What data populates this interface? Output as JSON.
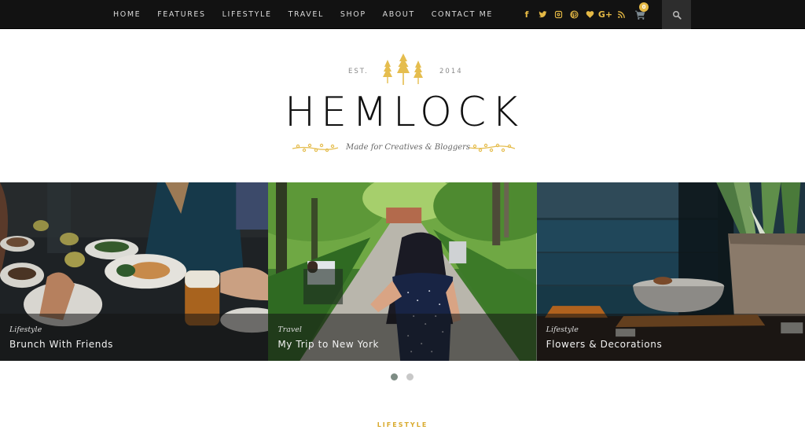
{
  "nav": {
    "items": [
      {
        "label": "HOME"
      },
      {
        "label": "FEATURES"
      },
      {
        "label": "LIFESTYLE"
      },
      {
        "label": "TRAVEL"
      },
      {
        "label": "SHOP"
      },
      {
        "label": "ABOUT"
      },
      {
        "label": "CONTACT ME"
      }
    ]
  },
  "social": {
    "icons": [
      "facebook-icon",
      "twitter-icon",
      "instagram-icon",
      "pinterest-icon",
      "bloglovin-heart-icon",
      "google-plus-icon",
      "rss-icon"
    ],
    "google_plus_label": "G+",
    "facebook_label": "f"
  },
  "cart": {
    "count": "0"
  },
  "header": {
    "est_left": "EST.",
    "est_right": "2014",
    "logo": "HEMLOCK",
    "tagline": "Made for Creatives & Bloggers"
  },
  "slider": {
    "slides": [
      {
        "category": "Lifestyle",
        "title": "Brunch With Friends"
      },
      {
        "category": "Travel",
        "title": "My Trip to New York"
      },
      {
        "category": "Lifestyle",
        "title": "Flowers & Decorations"
      }
    ],
    "pages": 2,
    "active_page": 1
  },
  "section": {
    "label": "LIFESTYLE"
  },
  "colors": {
    "accent": "#e5b945",
    "nav_bg": "#121212",
    "search_bg": "#2d2d2d"
  }
}
